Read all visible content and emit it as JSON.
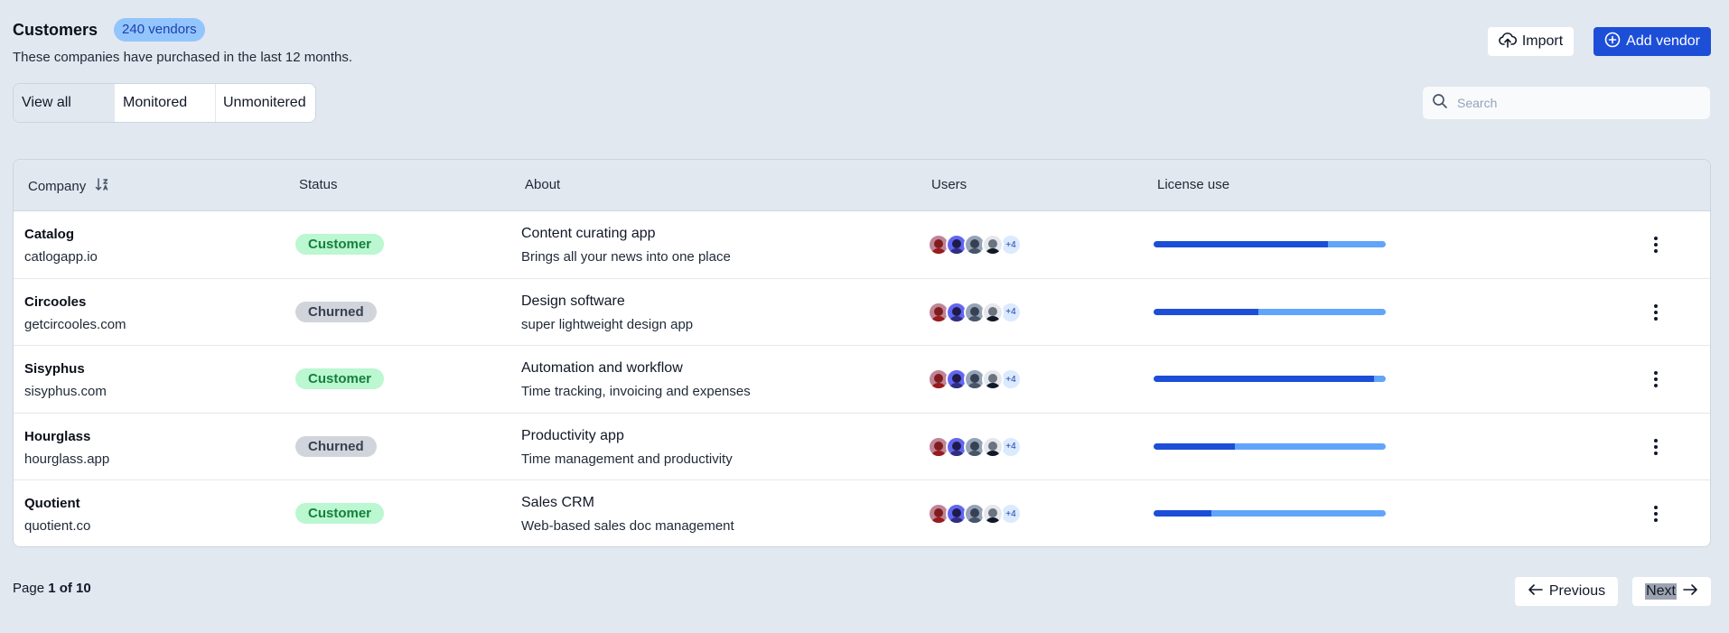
{
  "header": {
    "title": "Customers",
    "count_badge": "240 vendors",
    "subtitle": "These companies have purchased in the last 12 months."
  },
  "actions": {
    "import_label": "Import",
    "add_label": "Add vendor"
  },
  "tabs": [
    {
      "label": "View all",
      "active": true
    },
    {
      "label": "Monitored",
      "active": false
    },
    {
      "label": "Unmonitered",
      "active": false
    }
  ],
  "search": {
    "placeholder": "Search"
  },
  "table": {
    "columns": [
      "Company",
      "Status",
      "About",
      "Users",
      "License use"
    ],
    "rows": [
      {
        "name": "Catalog",
        "domain": "catlogapp.io",
        "status": "Customer",
        "about_title": "Content curating app",
        "about_desc": "Brings all your news into one place",
        "users_more": "+4",
        "license_use": 0.75
      },
      {
        "name": "Circooles",
        "domain": "getcircooles.com",
        "status": "Churned",
        "about_title": "Design software",
        "about_desc": "super lightweight design app",
        "users_more": "+4",
        "license_use": 0.45
      },
      {
        "name": "Sisyphus",
        "domain": "sisyphus.com",
        "status": "Customer",
        "about_title": "Automation and workflow",
        "about_desc": "Time tracking, invoicing and expenses",
        "users_more": "+4",
        "license_use": 0.95
      },
      {
        "name": "Hourglass",
        "domain": "hourglass.app",
        "status": "Churned",
        "about_title": "Productivity app",
        "about_desc": "Time management and productivity",
        "users_more": "+4",
        "license_use": 0.35
      },
      {
        "name": "Quotient",
        "domain": "quotient.co",
        "status": "Customer",
        "about_title": "Sales CRM",
        "about_desc": "Web-based sales doc management",
        "users_more": "+4",
        "license_use": 0.25
      }
    ]
  },
  "pagination": {
    "prefix": "Page",
    "current": "1 of 10",
    "previous_label": "Previous",
    "next_label": "Next"
  },
  "colors": {
    "accent": "#1d4ed8",
    "bar_track": "#60a5fa",
    "customer_bg": "#bbf7d0",
    "churned_bg": "#d1d5db"
  }
}
